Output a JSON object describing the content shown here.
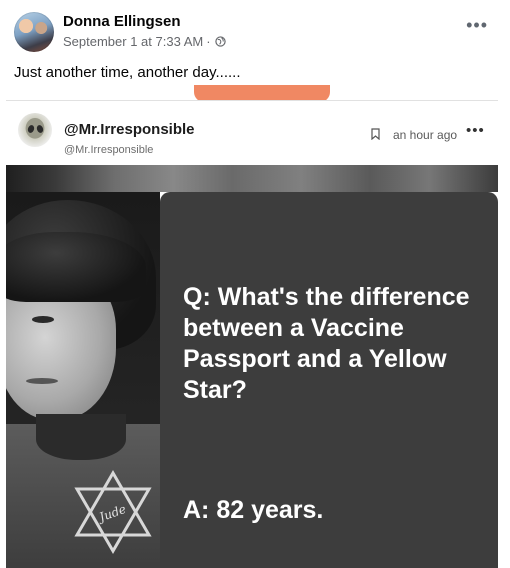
{
  "post": {
    "author": "Donna Ellingsen",
    "timestamp": "September 1 at 7:33 AM",
    "separator": "·",
    "more": "•••",
    "caption": "Just another time, another day......",
    "privacy_icon": "globe-icon"
  },
  "shared": {
    "display_name": "@Mr.Irresponsible",
    "handle": "@Mr.Irresponsible",
    "time": "an hour ago",
    "more": "•••",
    "bookmark_icon": "bookmark-icon"
  },
  "meme": {
    "question": "Q: What's the difference between a Vaccine Passport and a Yellow Star?",
    "answer": "A: 82 years.",
    "star_text": "Jude"
  },
  "colors": {
    "accent_tab": "#f08863",
    "panel": "#3d3d3d"
  }
}
